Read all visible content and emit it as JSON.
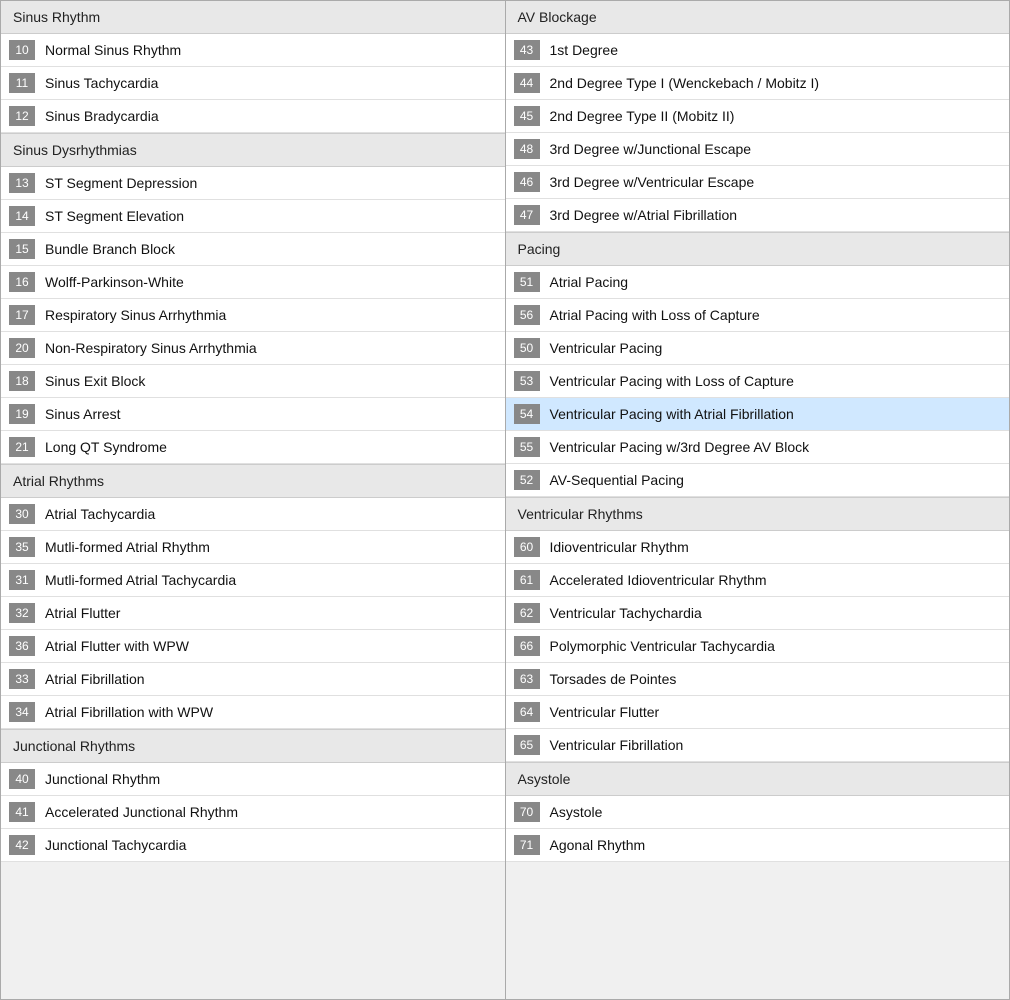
{
  "left_panel": {
    "sections": [
      {
        "header": "Sinus Rhythm",
        "items": [
          {
            "number": "10",
            "label": "Normal Sinus Rhythm"
          },
          {
            "number": "11",
            "label": "Sinus Tachycardia"
          },
          {
            "number": "12",
            "label": "Sinus Bradycardia"
          }
        ]
      },
      {
        "header": "Sinus Dysrhythmias",
        "items": [
          {
            "number": "13",
            "label": "ST Segment Depression"
          },
          {
            "number": "14",
            "label": "ST Segment Elevation"
          },
          {
            "number": "15",
            "label": "Bundle Branch Block"
          },
          {
            "number": "16",
            "label": "Wolff-Parkinson-White"
          },
          {
            "number": "17",
            "label": "Respiratory Sinus Arrhythmia"
          },
          {
            "number": "20",
            "label": "Non-Respiratory Sinus Arrhythmia"
          },
          {
            "number": "18",
            "label": "Sinus Exit Block"
          },
          {
            "number": "19",
            "label": "Sinus Arrest"
          },
          {
            "number": "21",
            "label": "Long QT Syndrome"
          }
        ]
      },
      {
        "header": "Atrial Rhythms",
        "items": [
          {
            "number": "30",
            "label": "Atrial Tachycardia"
          },
          {
            "number": "35",
            "label": "Mutli-formed Atrial Rhythm"
          },
          {
            "number": "31",
            "label": "Mutli-formed Atrial Tachycardia"
          },
          {
            "number": "32",
            "label": "Atrial Flutter"
          },
          {
            "number": "36",
            "label": "Atrial Flutter with WPW"
          },
          {
            "number": "33",
            "label": "Atrial Fibrillation"
          },
          {
            "number": "34",
            "label": "Atrial Fibrillation with WPW"
          }
        ]
      },
      {
        "header": "Junctional Rhythms",
        "items": [
          {
            "number": "40",
            "label": "Junctional Rhythm"
          },
          {
            "number": "41",
            "label": "Accelerated Junctional Rhythm"
          },
          {
            "number": "42",
            "label": "Junctional Tachycardia"
          }
        ]
      }
    ]
  },
  "right_panel": {
    "sections": [
      {
        "header": "AV Blockage",
        "items": [
          {
            "number": "43",
            "label": "1st Degree"
          },
          {
            "number": "44",
            "label": "2nd Degree Type I (Wenckebach / Mobitz I)"
          },
          {
            "number": "45",
            "label": "2nd Degree Type II (Mobitz II)"
          },
          {
            "number": "48",
            "label": "3rd Degree w/Junctional Escape"
          },
          {
            "number": "46",
            "label": "3rd Degree w/Ventricular Escape"
          },
          {
            "number": "47",
            "label": "3rd Degree w/Atrial Fibrillation"
          }
        ]
      },
      {
        "header": "Pacing",
        "items": [
          {
            "number": "51",
            "label": "Atrial Pacing"
          },
          {
            "number": "56",
            "label": "Atrial Pacing with Loss of Capture"
          },
          {
            "number": "50",
            "label": "Ventricular Pacing"
          },
          {
            "number": "53",
            "label": "Ventricular Pacing with Loss of Capture"
          },
          {
            "number": "54",
            "label": "Ventricular Pacing with Atrial Fibrillation",
            "highlighted": true
          },
          {
            "number": "55",
            "label": "Ventricular Pacing w/3rd Degree AV Block"
          },
          {
            "number": "52",
            "label": "AV-Sequential Pacing"
          }
        ]
      },
      {
        "header": "Ventricular Rhythms",
        "items": [
          {
            "number": "60",
            "label": "Idioventricular Rhythm"
          },
          {
            "number": "61",
            "label": "Accelerated Idioventricular Rhythm"
          },
          {
            "number": "62",
            "label": "Ventricular Tachychardia"
          },
          {
            "number": "66",
            "label": "Polymorphic Ventricular Tachycardia"
          },
          {
            "number": "63",
            "label": "Torsades de Pointes"
          },
          {
            "number": "64",
            "label": "Ventricular Flutter"
          },
          {
            "number": "65",
            "label": "Ventricular Fibrillation"
          }
        ]
      },
      {
        "header": "Asystole",
        "items": [
          {
            "number": "70",
            "label": "Asystole"
          },
          {
            "number": "71",
            "label": "Agonal Rhythm"
          }
        ]
      }
    ]
  }
}
